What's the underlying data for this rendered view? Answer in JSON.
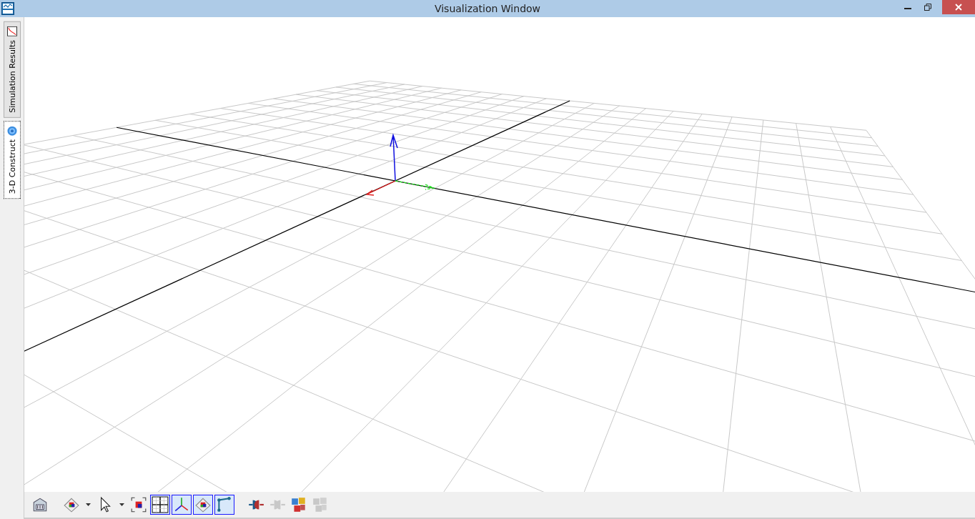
{
  "window": {
    "title": "Visualization Window"
  },
  "side_tabs": [
    {
      "label": "Simulation Results",
      "selected": false
    },
    {
      "label": "3-D Construct",
      "selected": true
    }
  ],
  "toolbar": [
    {
      "selected": false,
      "disabled": false,
      "caret": false
    },
    {
      "selected": false,
      "disabled": false,
      "caret": true
    },
    {
      "selected": false,
      "disabled": false,
      "caret": true
    },
    {
      "selected": false,
      "disabled": false,
      "caret": false
    },
    {
      "selected": true,
      "disabled": false,
      "caret": false
    },
    {
      "selected": true,
      "disabled": false,
      "caret": false
    },
    {
      "selected": true,
      "disabled": false,
      "caret": false
    },
    {
      "selected": true,
      "disabled": false,
      "caret": false
    },
    {
      "selected": false,
      "disabled": false,
      "caret": false
    },
    {
      "selected": false,
      "disabled": true,
      "caret": false
    },
    {
      "selected": false,
      "disabled": false,
      "caret": false
    },
    {
      "selected": false,
      "disabled": true,
      "caret": false
    }
  ]
}
